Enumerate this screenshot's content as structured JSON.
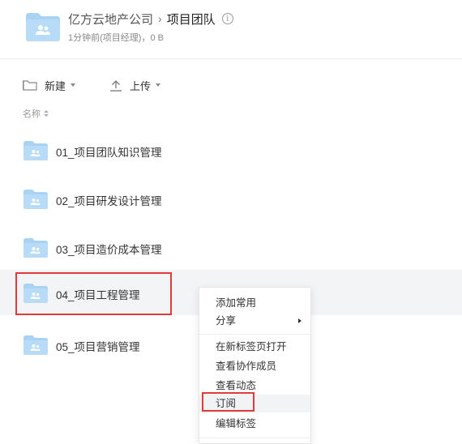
{
  "header": {
    "breadcrumb_parent": "亿方云地产公司",
    "breadcrumb_separator": "›",
    "breadcrumb_current": "项目团队",
    "info_glyph": "i",
    "meta": "1分钟前(项目经理)，0 B",
    "folder_icon": "folder-with-people-icon"
  },
  "toolbar": {
    "new_label": "新建",
    "upload_label": "上传",
    "new_icon": "new-folder-icon",
    "upload_icon": "upload-arrow-icon"
  },
  "list": {
    "column_name": "名称",
    "items": [
      {
        "name": "01_项目团队知识管理"
      },
      {
        "name": "02_项目研发设计管理"
      },
      {
        "name": "03_项目造价成本管理"
      },
      {
        "name": "04_项目工程管理",
        "highlighted": true
      },
      {
        "name": "05_项目营销管理"
      }
    ]
  },
  "context_menu": {
    "items": [
      {
        "label": "添加常用"
      },
      {
        "label": "分享",
        "has_submenu": true
      },
      {
        "label": "在新标签页打开"
      },
      {
        "label": "查看协作成员"
      },
      {
        "label": "查看动态"
      },
      {
        "label": "订阅",
        "highlighted": true
      },
      {
        "label": "编辑标签"
      }
    ]
  },
  "colors": {
    "folder_blue": "#a8d3f3",
    "folder_people": "#ffffff",
    "highlight_red": "#e03a3a",
    "hover_bg": "#f3f4f6"
  }
}
